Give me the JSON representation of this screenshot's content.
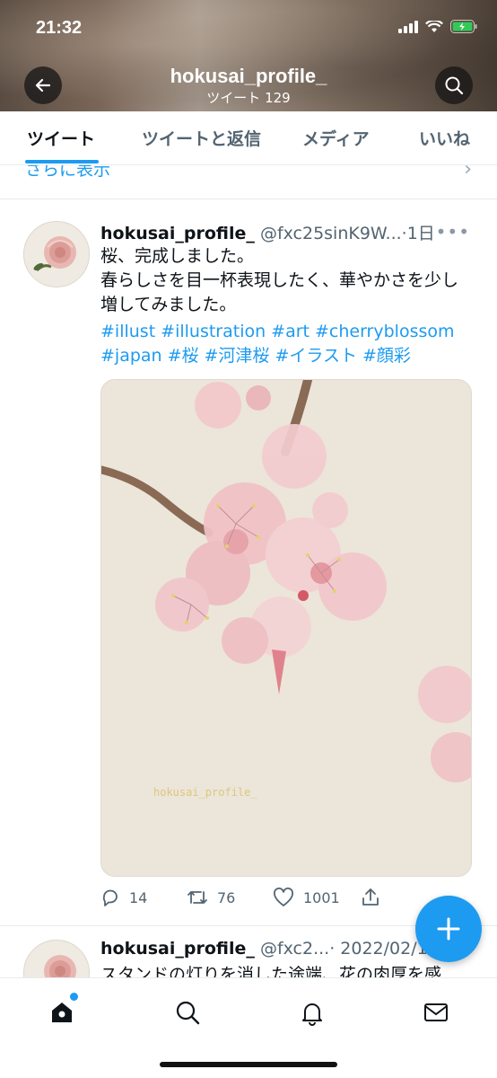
{
  "status_bar": {
    "time": "21:32"
  },
  "profile": {
    "name": "hokusai_profile_",
    "tweet_count": "ツイート 129"
  },
  "tabs": [
    {
      "label": "ツイート",
      "active": true
    },
    {
      "label": "ツイートと返信",
      "active": false
    },
    {
      "label": "メディア",
      "active": false
    },
    {
      "label": "いいね",
      "active": false
    }
  ],
  "show_more": {
    "label": "さらに表示"
  },
  "tweets": [
    {
      "name": "hokusai_profile_",
      "handle": "@fxc25sinK9W...",
      "time": "·1日",
      "text_lines": [
        "桜、完成しました。",
        "春らしさを目一杯表現したく、華やかさを少し増してみました。"
      ],
      "hashtags": [
        "#illust",
        "#illustration",
        "#art",
        "#cherryblossom",
        "#japan",
        "#桜",
        "#河津桜",
        "#イラスト",
        "#顔彩"
      ],
      "image_watermark": "hokusai_profile_",
      "replies": "14",
      "retweets": "76",
      "likes": "1001"
    },
    {
      "name": "hokusai_profile_",
      "handle": "@fxc2...",
      "time": "· 2022/02/1",
      "text": "スタンドの灯りを消した途端、花の肉厚を感"
    }
  ],
  "colors": {
    "accent": "#1d9bf0",
    "text": "#0f1419",
    "muted": "#536471"
  }
}
